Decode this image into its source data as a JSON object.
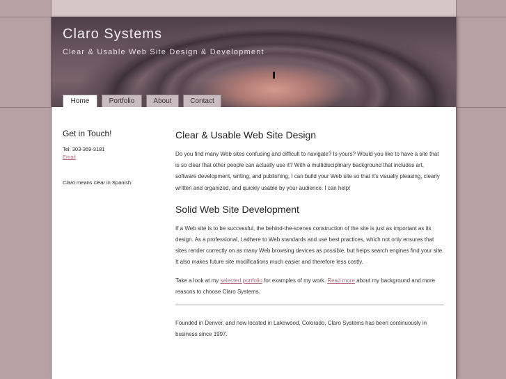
{
  "site": {
    "title": "Claro Systems",
    "tagline": "Clear & Usable Web Site Design & Development"
  },
  "nav": {
    "tabs": [
      {
        "label": "Home",
        "active": true
      },
      {
        "label": "Portfolio",
        "active": false
      },
      {
        "label": "About",
        "active": false
      },
      {
        "label": "Contact",
        "active": false
      }
    ]
  },
  "sidebar": {
    "heading": "Get in Touch!",
    "tel": "Tel: 303-369-3181",
    "email_link": "Email",
    "claro_word": "Claro",
    "means_text": " means ",
    "clear_word": "clear",
    "in_spanish": " in Spanish."
  },
  "main": {
    "heading1": "Clear & Usable Web Site Design",
    "para1": "Do you find many Web sites confusing and difficult to navigate? Is yours? Would you like to have a site that is so clear that other people can actually use it? With a multidisciplinary background that includes art, software development, writing, and publishing, I can build your Web site so that it's visually pleasing, clearly written and organized, and quickly usable by your audience. I can help!",
    "heading2": "Solid Web Site Development",
    "para2": "If a Web site is to be successful, the behind-the-scenes construction of the site is just as important as its design. As a professional, I adhere to Web standards and use best practices, which not only ensures that sites render correctly on as many Web browsing devices as possible, but helps search engines find your site. It also makes future site modifications much easier and therefore less costly.",
    "para3_pre": "Take a look at my ",
    "portfolio_link": "selected portfolio",
    "para3_mid": " for examples of my work. ",
    "readmore_link": "Read more",
    "para3_post": " about my background and more reasons to choose Claro Systems.",
    "founded": "Founded in Denver, and now located in Lakewood, Colorado, Claro Systems has been continuously in business since 1997."
  },
  "colors": {
    "background": "#b8a1a5",
    "link": "#b06a7a",
    "page": "#ffffff"
  }
}
